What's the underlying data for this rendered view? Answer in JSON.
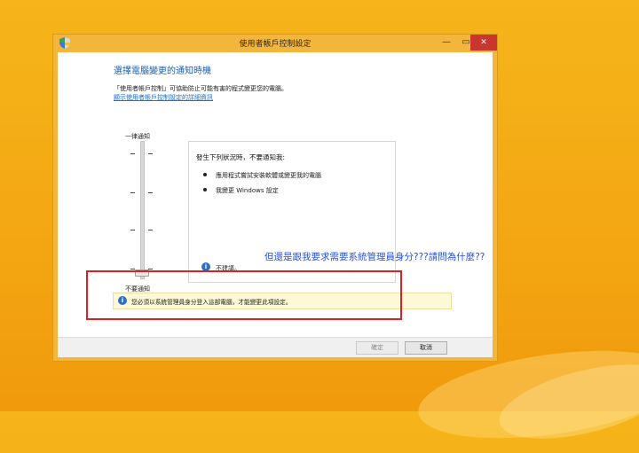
{
  "window": {
    "title": "使用者帳戶控制設定",
    "controls": {
      "minimize": "—",
      "maximize": "▭",
      "close": "✕"
    }
  },
  "content": {
    "heading": "選擇電腦變更的通知時機",
    "description": "「使用者帳戶控制」可協助防止可能有害的程式變更您的電腦。",
    "link": "顯示使用者帳戶控制設定的詳細資訊"
  },
  "slider": {
    "top_label": "一律通知",
    "bottom_label": "不要通知",
    "level": 0,
    "levels": 4
  },
  "panel": {
    "title": "發生下列狀況時，不要通知我:",
    "items": [
      "應用程式嘗試安裝軟體或變更我的電腦",
      "我變更 Windows 設定"
    ],
    "recommendation": "不建議。"
  },
  "warning": {
    "text": "您必須以系統管理員身分登入這部電腦，才能變更此項設定。"
  },
  "buttons": {
    "ok": "確定",
    "cancel": "取消"
  },
  "annotation": {
    "text": "但還是跟我要求需要系統管理員身分???請問為什麼??"
  },
  "colors": {
    "accent": "#1e5fa8",
    "annotation": "#2a52d9",
    "highlight_box": "#e02020",
    "titlebar": "#f4b63a"
  }
}
